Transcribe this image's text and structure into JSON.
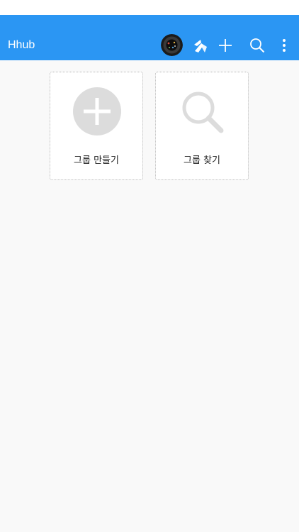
{
  "app_bar": {
    "title": "Hhub",
    "background": "#2b96f3",
    "icons": [
      "avatar",
      "hhub-logo-icon",
      "plus-icon",
      "search-icon",
      "more-vertical-icon"
    ]
  },
  "cards": [
    {
      "label": "그룹 만들기",
      "icon": "add-circle-icon"
    },
    {
      "label": "그룹 찾기",
      "icon": "search-icon"
    }
  ],
  "colors": {
    "accent": "#2b96f3",
    "background": "#f9f9f9",
    "card_icon": "#dcdcdc"
  }
}
